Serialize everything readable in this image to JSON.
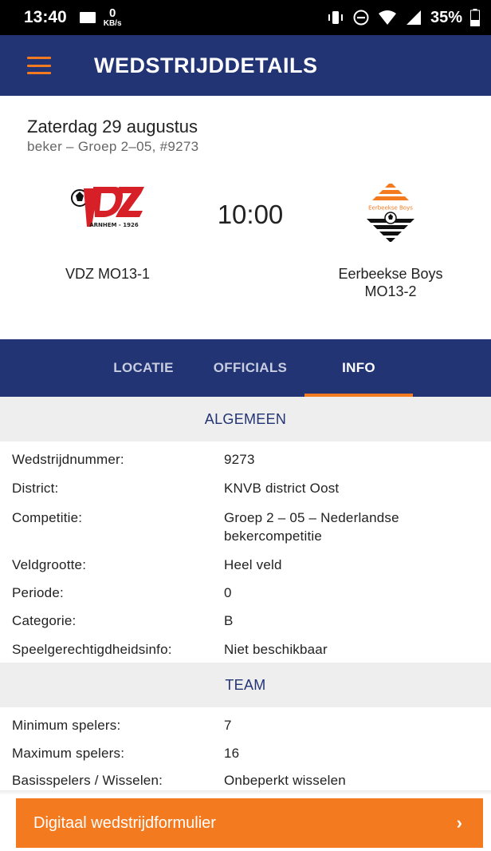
{
  "status_bar": {
    "time": "13:40",
    "speed_value": "0",
    "speed_unit": "KB/s",
    "battery": "35%",
    "icons": [
      "vibrate-icon",
      "do-not-disturb-icon",
      "wifi-icon",
      "signal-icon",
      "battery-icon"
    ]
  },
  "app_bar": {
    "menu_icon": "hamburger-icon",
    "title": "WEDSTRIJDDETAILS",
    "accent": "#f47a20",
    "background": "#233475"
  },
  "match": {
    "date": "Zaterdag 29 augustus",
    "subtitle": "beker – Groep 2–05, #9273",
    "kickoff": "10:00",
    "home": {
      "name": "VDZ MO13-1",
      "logo_text": "VDZ",
      "logo_subtext": "ARNHEM - 1926"
    },
    "away": {
      "name": "Eerbeekse Boys MO13-2",
      "logo_text": "Eerbeekse Boys"
    }
  },
  "tabs": [
    {
      "label": "LOCATIE",
      "active": false
    },
    {
      "label": "OFFICIALS",
      "active": false
    },
    {
      "label": "INFO",
      "active": true
    }
  ],
  "sections": {
    "general": {
      "title": "ALGEMEEN",
      "rows": [
        {
          "label": "Wedstrijdnummer:",
          "value": "9273"
        },
        {
          "label": "District:",
          "value": "KNVB district Oost"
        },
        {
          "label": "Competitie:",
          "value": "Groep 2 – 05 – Nederlandse bekercompetitie"
        },
        {
          "label": "Veldgrootte:",
          "value": "Heel veld"
        },
        {
          "label": "Periode:",
          "value": "0"
        },
        {
          "label": "Categorie:",
          "value": "B"
        },
        {
          "label": "Speelgerechtigdheidsinfo:",
          "value": "Niet beschikbaar"
        }
      ]
    },
    "team": {
      "title": "TEAM",
      "rows": [
        {
          "label": "Minimum spelers:",
          "value": "7"
        },
        {
          "label": "Maximum spelers:",
          "value": "16"
        },
        {
          "label": "Basisspelers / Wisselen:",
          "value": "Onbeperkt wisselen"
        }
      ]
    }
  },
  "cta": {
    "label": "Digitaal wedstrijdformulier",
    "chevron": "›"
  }
}
